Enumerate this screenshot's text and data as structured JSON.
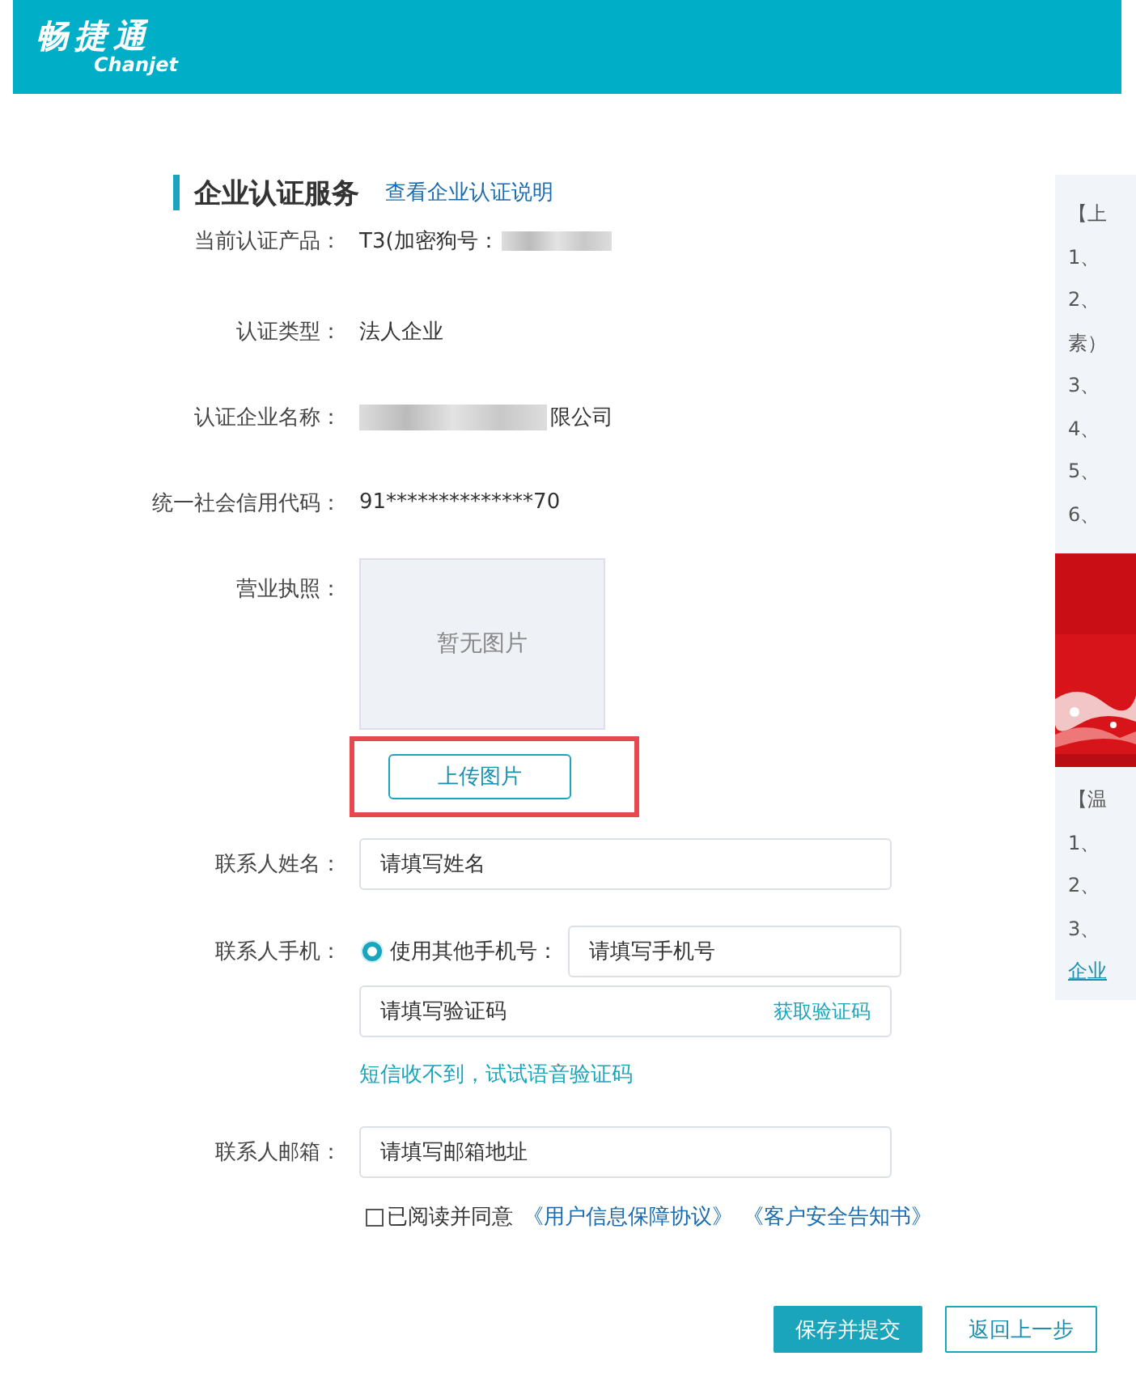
{
  "header": {
    "logo_cn": "畅捷通",
    "logo_en": "Chanjet"
  },
  "section": {
    "title": "企业认证服务",
    "link": "查看企业认证说明"
  },
  "info_rows": [
    {
      "label": "当前认证产品：",
      "value": "T3(加密狗号：",
      "kind": "redacted_after"
    },
    {
      "label": "认证类型：",
      "value": "法人企业",
      "kind": "text"
    },
    {
      "label": "认证企业名称：",
      "value": "限公司",
      "kind": "redacted_before"
    },
    {
      "label": "统一社会信用代码：",
      "value": "91**************70",
      "kind": "text"
    }
  ],
  "license": {
    "label": "营业执照：",
    "empty_text": "暂无图片",
    "upload_button": "上传图片",
    "highlighted": true
  },
  "contact_name": {
    "label": "联系人姓名：",
    "placeholder": "请填写姓名"
  },
  "contact_phone": {
    "label": "联系人手机：",
    "option": "使用其他手机号：",
    "selected": true,
    "placeholder": "请填写手机号",
    "code_placeholder": "请填写验证码",
    "code_button": "获取验证码",
    "voice_link": "短信收不到，试试语音验证码"
  },
  "contact_email": {
    "label": "联系人邮箱：",
    "placeholder": "请填写邮箱地址"
  },
  "agreement": {
    "checked": false,
    "text": "已阅读并同意",
    "links": [
      "《用户信息保障协议》",
      "《客户安全告知书》"
    ]
  },
  "buttons": [
    {
      "label": "保存并提交",
      "kind": "primary"
    },
    {
      "label": "返回上一步",
      "kind": "secondary"
    }
  ],
  "side_panel": [
    {
      "kind": "text",
      "text": "【上"
    },
    {
      "kind": "text",
      "text": "1、"
    },
    {
      "kind": "text",
      "text": "2、"
    },
    {
      "kind": "text",
      "text": "素）"
    },
    {
      "kind": "text",
      "text": "3、"
    },
    {
      "kind": "text",
      "text": "4、"
    },
    {
      "kind": "text",
      "text": "5、"
    },
    {
      "kind": "text",
      "text": "6、"
    },
    {
      "kind": "picture"
    },
    {
      "kind": "text",
      "text": "【温"
    },
    {
      "kind": "text",
      "text": "1、"
    },
    {
      "kind": "text",
      "text": "2、"
    },
    {
      "kind": "text",
      "text": "3、"
    },
    {
      "kind": "link",
      "text": "企业"
    }
  ]
}
